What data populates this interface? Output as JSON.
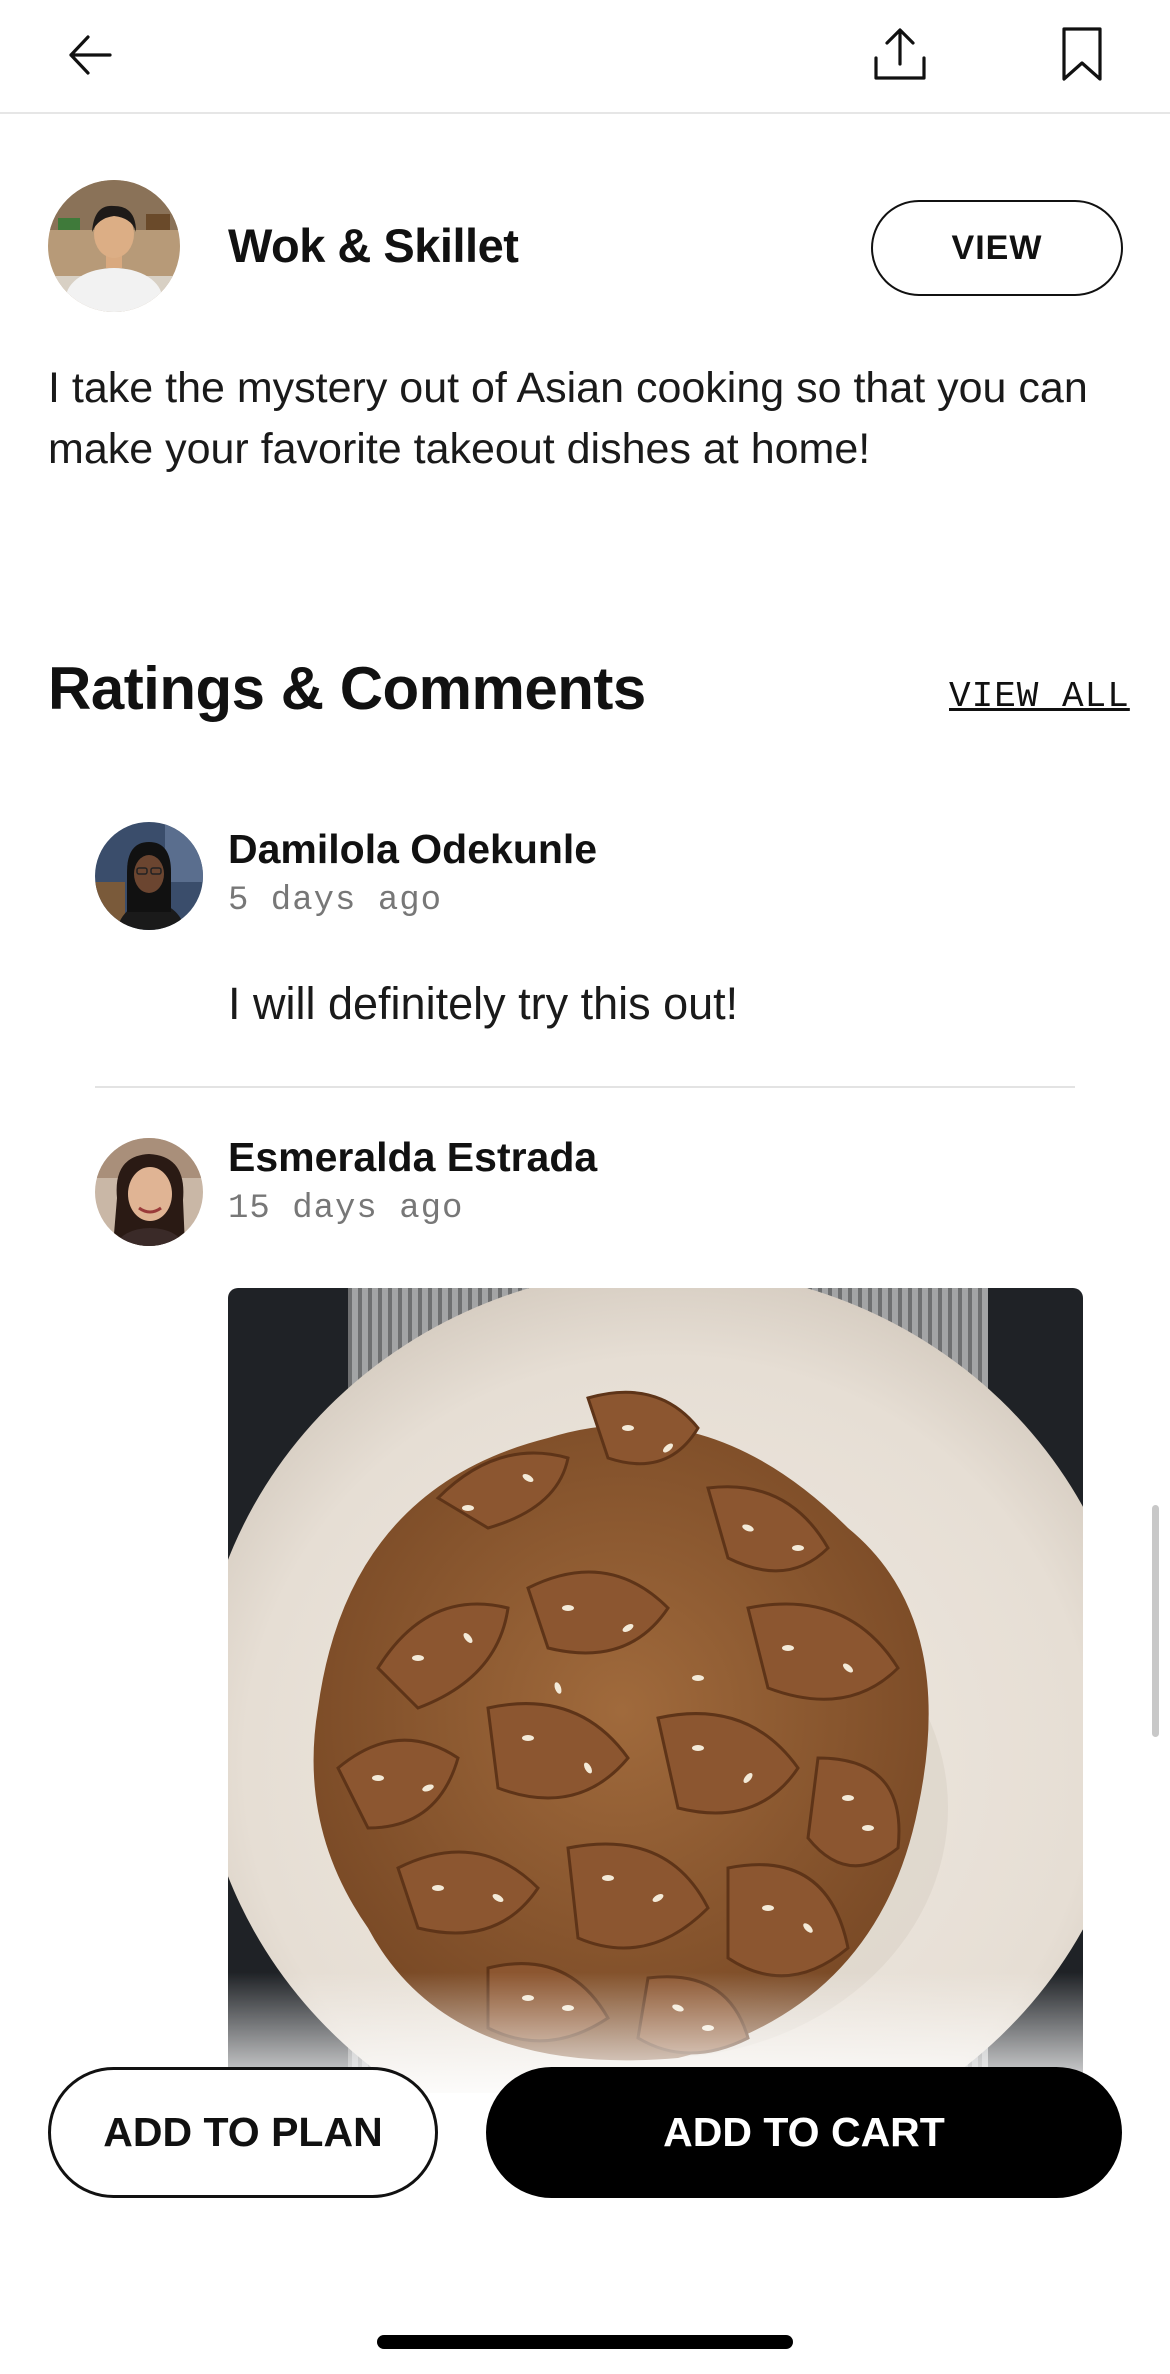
{
  "header": {
    "back_icon": "arrow-left-icon",
    "share_icon": "share-upload-icon",
    "bookmark_icon": "bookmark-icon"
  },
  "creator": {
    "name": "Wok & Skillet",
    "view_label": "VIEW",
    "bio": "I take the mystery out of Asian cooking so that you can make your favorite takeout dishes at home!"
  },
  "ratings": {
    "title": "Ratings & Comments",
    "view_all_label": "VIEW ALL",
    "comments": [
      {
        "name": "Damilola Odekunle",
        "time": "5 days ago",
        "text": "I will definitely try this out!"
      },
      {
        "name": "Esmeralda Estrada",
        "time": "15 days ago"
      }
    ]
  },
  "actions": {
    "add_to_plan": "ADD TO PLAN",
    "add_to_cart": "ADD TO CART"
  },
  "colors": {
    "primary": "#000000",
    "background": "#ffffff",
    "muted_text": "#777777",
    "divider": "#e3e3e3"
  }
}
